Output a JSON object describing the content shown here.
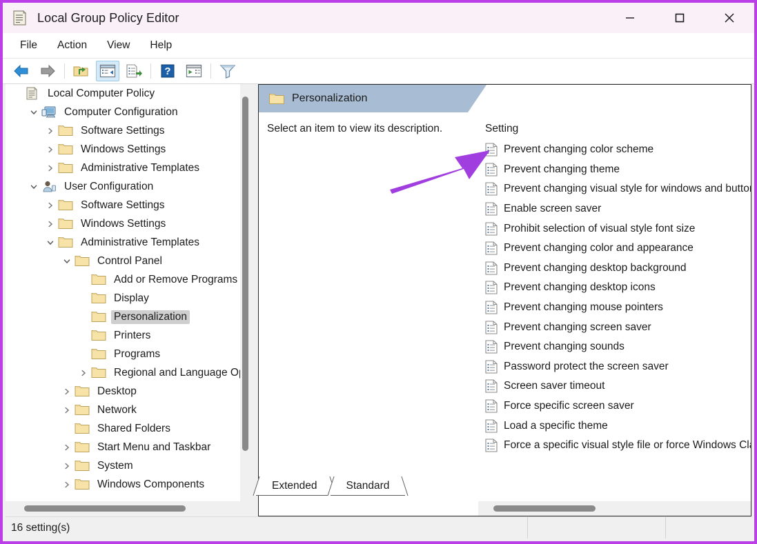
{
  "window": {
    "title": "Local Group Policy Editor",
    "icon": "policy-document-icon",
    "accent_border": "#bb3fe8",
    "titlebar_bg": "#faf0f7",
    "controls": {
      "minimize": "Minimize",
      "maximize": "Maximize",
      "close": "Close"
    }
  },
  "menubar": {
    "items": [
      {
        "label": "File"
      },
      {
        "label": "Action"
      },
      {
        "label": "View"
      },
      {
        "label": "Help"
      }
    ]
  },
  "toolbar": {
    "buttons": [
      {
        "name": "back-button",
        "icon": "left-arrow-icon"
      },
      {
        "name": "forward-button",
        "icon": "right-arrow-icon"
      },
      {
        "name": "up-one-level-button",
        "icon": "folder-up-icon"
      },
      {
        "name": "show-hide-tree-button",
        "icon": "window-panes-icon",
        "active": true
      },
      {
        "name": "export-list-button",
        "icon": "export-list-icon"
      },
      {
        "name": "help-button",
        "icon": "question-mark-icon"
      },
      {
        "name": "show-pane-button",
        "icon": "window-play-icon"
      },
      {
        "name": "filter-button",
        "icon": "funnel-icon"
      }
    ]
  },
  "tree": {
    "nodes": [
      {
        "label": "Local Computer Policy",
        "indent": 0,
        "expander": "none",
        "icon": "policy-document-icon",
        "selected": false
      },
      {
        "label": "Computer Configuration",
        "indent": 1,
        "expander": "expanded",
        "icon": "computer-icon",
        "selected": false
      },
      {
        "label": "Software Settings",
        "indent": 2,
        "expander": "collapsed",
        "icon": "folder-icon",
        "selected": false
      },
      {
        "label": "Windows Settings",
        "indent": 2,
        "expander": "collapsed",
        "icon": "folder-icon",
        "selected": false
      },
      {
        "label": "Administrative Templates",
        "indent": 2,
        "expander": "collapsed",
        "icon": "folder-icon",
        "selected": false
      },
      {
        "label": "User Configuration",
        "indent": 1,
        "expander": "expanded",
        "icon": "user-icon",
        "selected": false
      },
      {
        "label": "Software Settings",
        "indent": 2,
        "expander": "collapsed",
        "icon": "folder-icon",
        "selected": false
      },
      {
        "label": "Windows Settings",
        "indent": 2,
        "expander": "collapsed",
        "icon": "folder-icon",
        "selected": false
      },
      {
        "label": "Administrative Templates",
        "indent": 2,
        "expander": "expanded",
        "icon": "folder-icon",
        "selected": false
      },
      {
        "label": "Control Panel",
        "indent": 3,
        "expander": "expanded",
        "icon": "folder-icon",
        "selected": false
      },
      {
        "label": "Add or Remove Programs",
        "indent": 4,
        "expander": "none",
        "icon": "folder-icon",
        "selected": false
      },
      {
        "label": "Display",
        "indent": 4,
        "expander": "none",
        "icon": "folder-icon",
        "selected": false
      },
      {
        "label": "Personalization",
        "indent": 4,
        "expander": "none",
        "icon": "folder-icon",
        "selected": true
      },
      {
        "label": "Printers",
        "indent": 4,
        "expander": "none",
        "icon": "folder-icon",
        "selected": false
      },
      {
        "label": "Programs",
        "indent": 4,
        "expander": "none",
        "icon": "folder-icon",
        "selected": false
      },
      {
        "label": "Regional and Language Options",
        "indent": 4,
        "expander": "collapsed",
        "icon": "folder-icon",
        "selected": false
      },
      {
        "label": "Desktop",
        "indent": 3,
        "expander": "collapsed",
        "icon": "folder-icon",
        "selected": false
      },
      {
        "label": "Network",
        "indent": 3,
        "expander": "collapsed",
        "icon": "folder-icon",
        "selected": false
      },
      {
        "label": "Shared Folders",
        "indent": 3,
        "expander": "none",
        "icon": "folder-icon",
        "selected": false
      },
      {
        "label": "Start Menu and Taskbar",
        "indent": 3,
        "expander": "collapsed",
        "icon": "folder-icon",
        "selected": false
      },
      {
        "label": "System",
        "indent": 3,
        "expander": "collapsed",
        "icon": "folder-icon",
        "selected": false
      },
      {
        "label": "Windows Components",
        "indent": 3,
        "expander": "collapsed",
        "icon": "folder-icon",
        "selected": false
      }
    ]
  },
  "details": {
    "header_title": "Personalization",
    "header_icon": "folder-icon",
    "description_placeholder": "Select an item to view its description.",
    "column_header": "Setting",
    "settings": [
      {
        "label": "Prevent changing color scheme",
        "icon": "policy-setting-icon"
      },
      {
        "label": "Prevent changing theme",
        "icon": "policy-setting-icon"
      },
      {
        "label": "Prevent changing visual style for windows and buttons",
        "icon": "policy-setting-icon"
      },
      {
        "label": "Enable screen saver",
        "icon": "policy-setting-icon"
      },
      {
        "label": "Prohibit selection of visual style font size",
        "icon": "policy-setting-icon"
      },
      {
        "label": "Prevent changing color and appearance",
        "icon": "policy-setting-icon"
      },
      {
        "label": "Prevent changing desktop background",
        "icon": "policy-setting-icon"
      },
      {
        "label": "Prevent changing desktop icons",
        "icon": "policy-setting-icon"
      },
      {
        "label": "Prevent changing mouse pointers",
        "icon": "policy-setting-icon"
      },
      {
        "label": "Prevent changing screen saver",
        "icon": "policy-setting-icon"
      },
      {
        "label": "Prevent changing sounds",
        "icon": "policy-setting-icon"
      },
      {
        "label": "Password protect the screen saver",
        "icon": "policy-setting-icon"
      },
      {
        "label": "Screen saver timeout",
        "icon": "policy-setting-icon"
      },
      {
        "label": "Force specific screen saver",
        "icon": "policy-setting-icon"
      },
      {
        "label": "Load a specific theme",
        "icon": "policy-setting-icon"
      },
      {
        "label": "Force a specific visual style file or force Windows Classic",
        "icon": "policy-setting-icon"
      }
    ]
  },
  "tabs": [
    {
      "label": "Extended",
      "selected": false
    },
    {
      "label": "Standard",
      "selected": true
    }
  ],
  "statusbar": {
    "count_text": "16 setting(s)",
    "cell2": "",
    "cell3": ""
  },
  "annotation": {
    "type": "arrow",
    "color": "#a13ee0",
    "points_to": "Prevent changing color scheme"
  }
}
